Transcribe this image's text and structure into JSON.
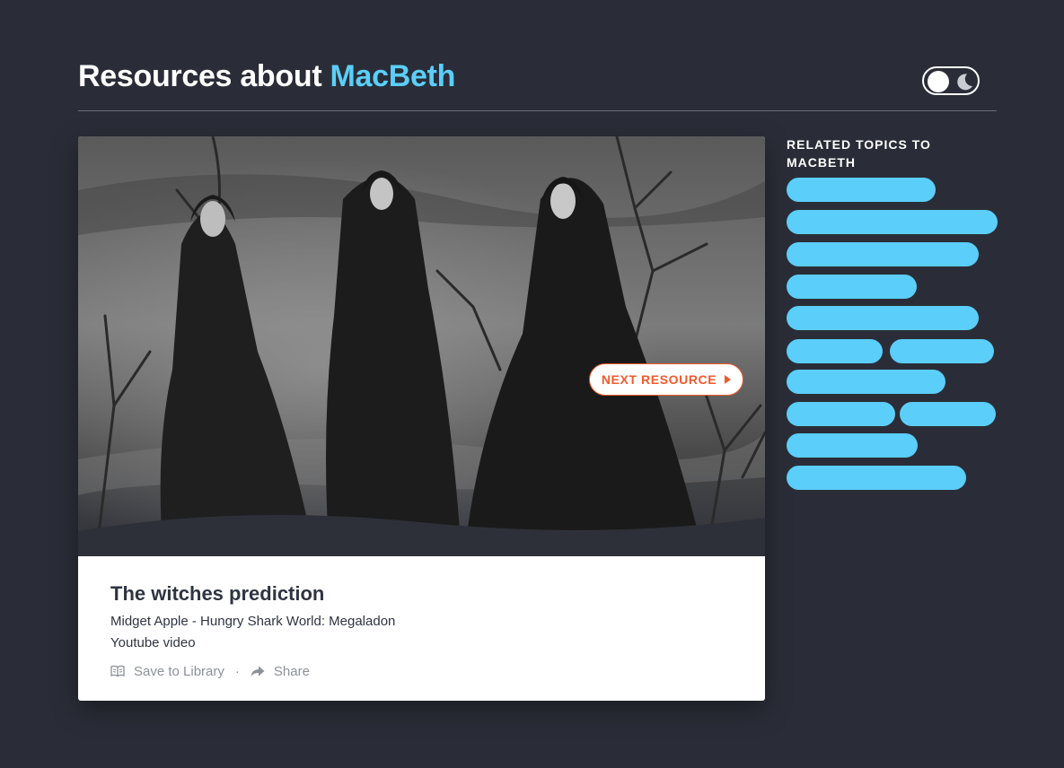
{
  "header": {
    "title_prefix": "Resources about",
    "title_topic": "MacBeth"
  },
  "theme_toggle": {
    "state": "light",
    "knob_icon": "circle-knob",
    "alt_icon": "moon-icon"
  },
  "resource": {
    "image_icon": "witches-photo",
    "title": "The witches prediction",
    "subtitle": "Midget Apple - Hungry Shark World: Megaladon",
    "type": "Youtube video",
    "save_label": "Save to Library",
    "separator": "·",
    "share_label": "Share",
    "next_label": "NEXT RESOURCE"
  },
  "related": {
    "heading": "RELATED TOPICS TO MACBETH",
    "pill_count": 12
  },
  "colors": {
    "background": "#2a2d37",
    "accent": "#5bcefa",
    "cta": "#f05a2a",
    "text_dark": "#2f3441",
    "text_muted": "#8d9099"
  }
}
